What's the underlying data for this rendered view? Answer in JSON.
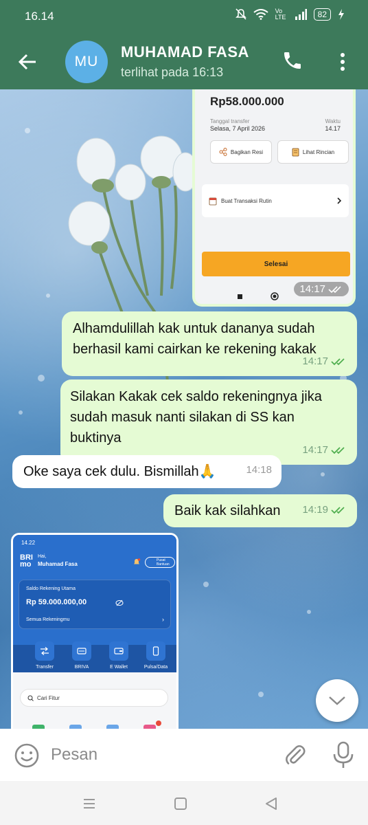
{
  "status_bar": {
    "time": "16.14",
    "network": "Vo LTE",
    "battery": "82"
  },
  "contact": {
    "initials": "MU",
    "name": "MUHAMAD FASA",
    "last_seen": "terlihat pada  16:13"
  },
  "transfer_receipt": {
    "amount": "Rp58.000.000",
    "date_label": "Tanggal transfer",
    "date_value": "Selasa, 7 April 2026",
    "time_label": "Waktu",
    "time_value": "14.17",
    "share_label": "Bagikan Resi",
    "detail_label": "Lihat Rincian",
    "routine_label": "Buat Transaksi Rutin",
    "done_label": "Selesai",
    "sent_time": "14:17"
  },
  "messages": [
    {
      "direction": "out",
      "text": "Alhamdulillah kak untuk dananya sudah berhasil kami cairkan ke rekening kakak",
      "time": "14:17"
    },
    {
      "direction": "out",
      "text": "Silakan Kakak cek saldo rekeningnya jika sudah masuk nanti silakan di SS kan buktinya",
      "time": "14:17"
    },
    {
      "direction": "in",
      "text": "Oke saya cek dulu. Bismillah🙏",
      "time": "14:18"
    },
    {
      "direction": "out",
      "text": "Baik kak silahkan",
      "time": "14:19"
    }
  ],
  "bank_screenshot": {
    "time": "14.22",
    "brand": "BRI mo",
    "greeting": "Hai,",
    "user_name": "Muhamad Fasa",
    "help_label": "Pusat Bantuan",
    "balance_label": "Saldo Rekening Utama",
    "balance_value": "Rp 59.000.000,00",
    "accounts_label": "Semua Rekeningmu",
    "menu": [
      "Transfer",
      "BRIVA",
      "E Wallet",
      "Pulsa/Data"
    ],
    "search_label": "Cari Fitur"
  },
  "input": {
    "placeholder": "Pesan"
  },
  "colors": {
    "header": "#3d7a5b",
    "outgoing_bubble": "#e5fbd4",
    "incoming_bubble": "#ffffff",
    "read_check": "#4fae4e",
    "done_button": "#f6a623"
  }
}
